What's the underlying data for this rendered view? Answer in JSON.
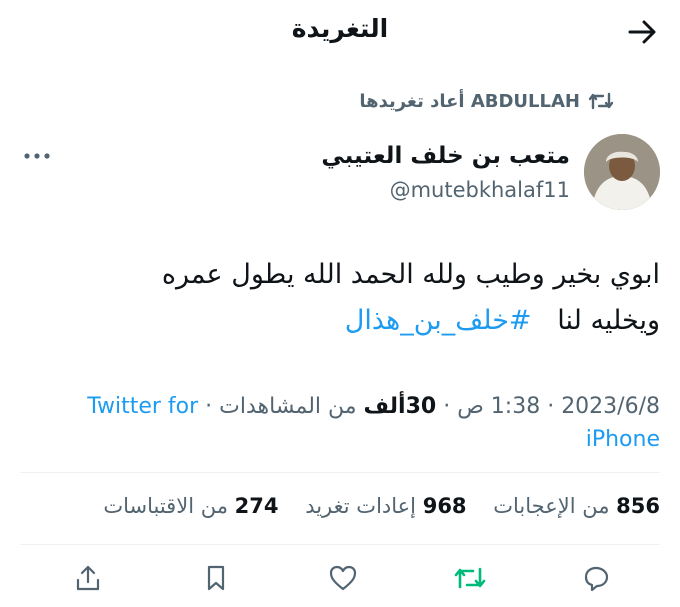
{
  "header": {
    "title": "التغريدة"
  },
  "retweet": {
    "label": "ABDULLAH أعاد تغريدها"
  },
  "author": {
    "display_name": "متعب بن خلف العتيبي",
    "handle": "@mutebkhalaf11"
  },
  "tweet": {
    "line1": "ابوي بخير وطيب ولله الحمد الله يطول عمره",
    "line2_prefix": "ويخليه لنا",
    "hashtag": "#خلف_بن_هذال"
  },
  "meta": {
    "date": "2023/6/8",
    "time": "1:38 ص",
    "views_value": "30ألف",
    "views_label": "من المشاهدات",
    "source": "Twitter for iPhone",
    "sep": "·"
  },
  "stats": {
    "likes_count": "856",
    "likes_label": "من الإعجابات",
    "retweets_count": "968",
    "retweets_label": "إعادات تغريد",
    "quotes_count": "274",
    "quotes_label": "من الاقتباسات"
  },
  "colors": {
    "accent": "#1d9bf0",
    "muted": "#536471",
    "retweet_green": "#00ba7c",
    "text": "#0f1419"
  },
  "icons": [
    "arrow-right-icon",
    "retweet-icon",
    "more-icon",
    "reply-icon",
    "like-icon",
    "bookmark-icon",
    "share-icon"
  ]
}
